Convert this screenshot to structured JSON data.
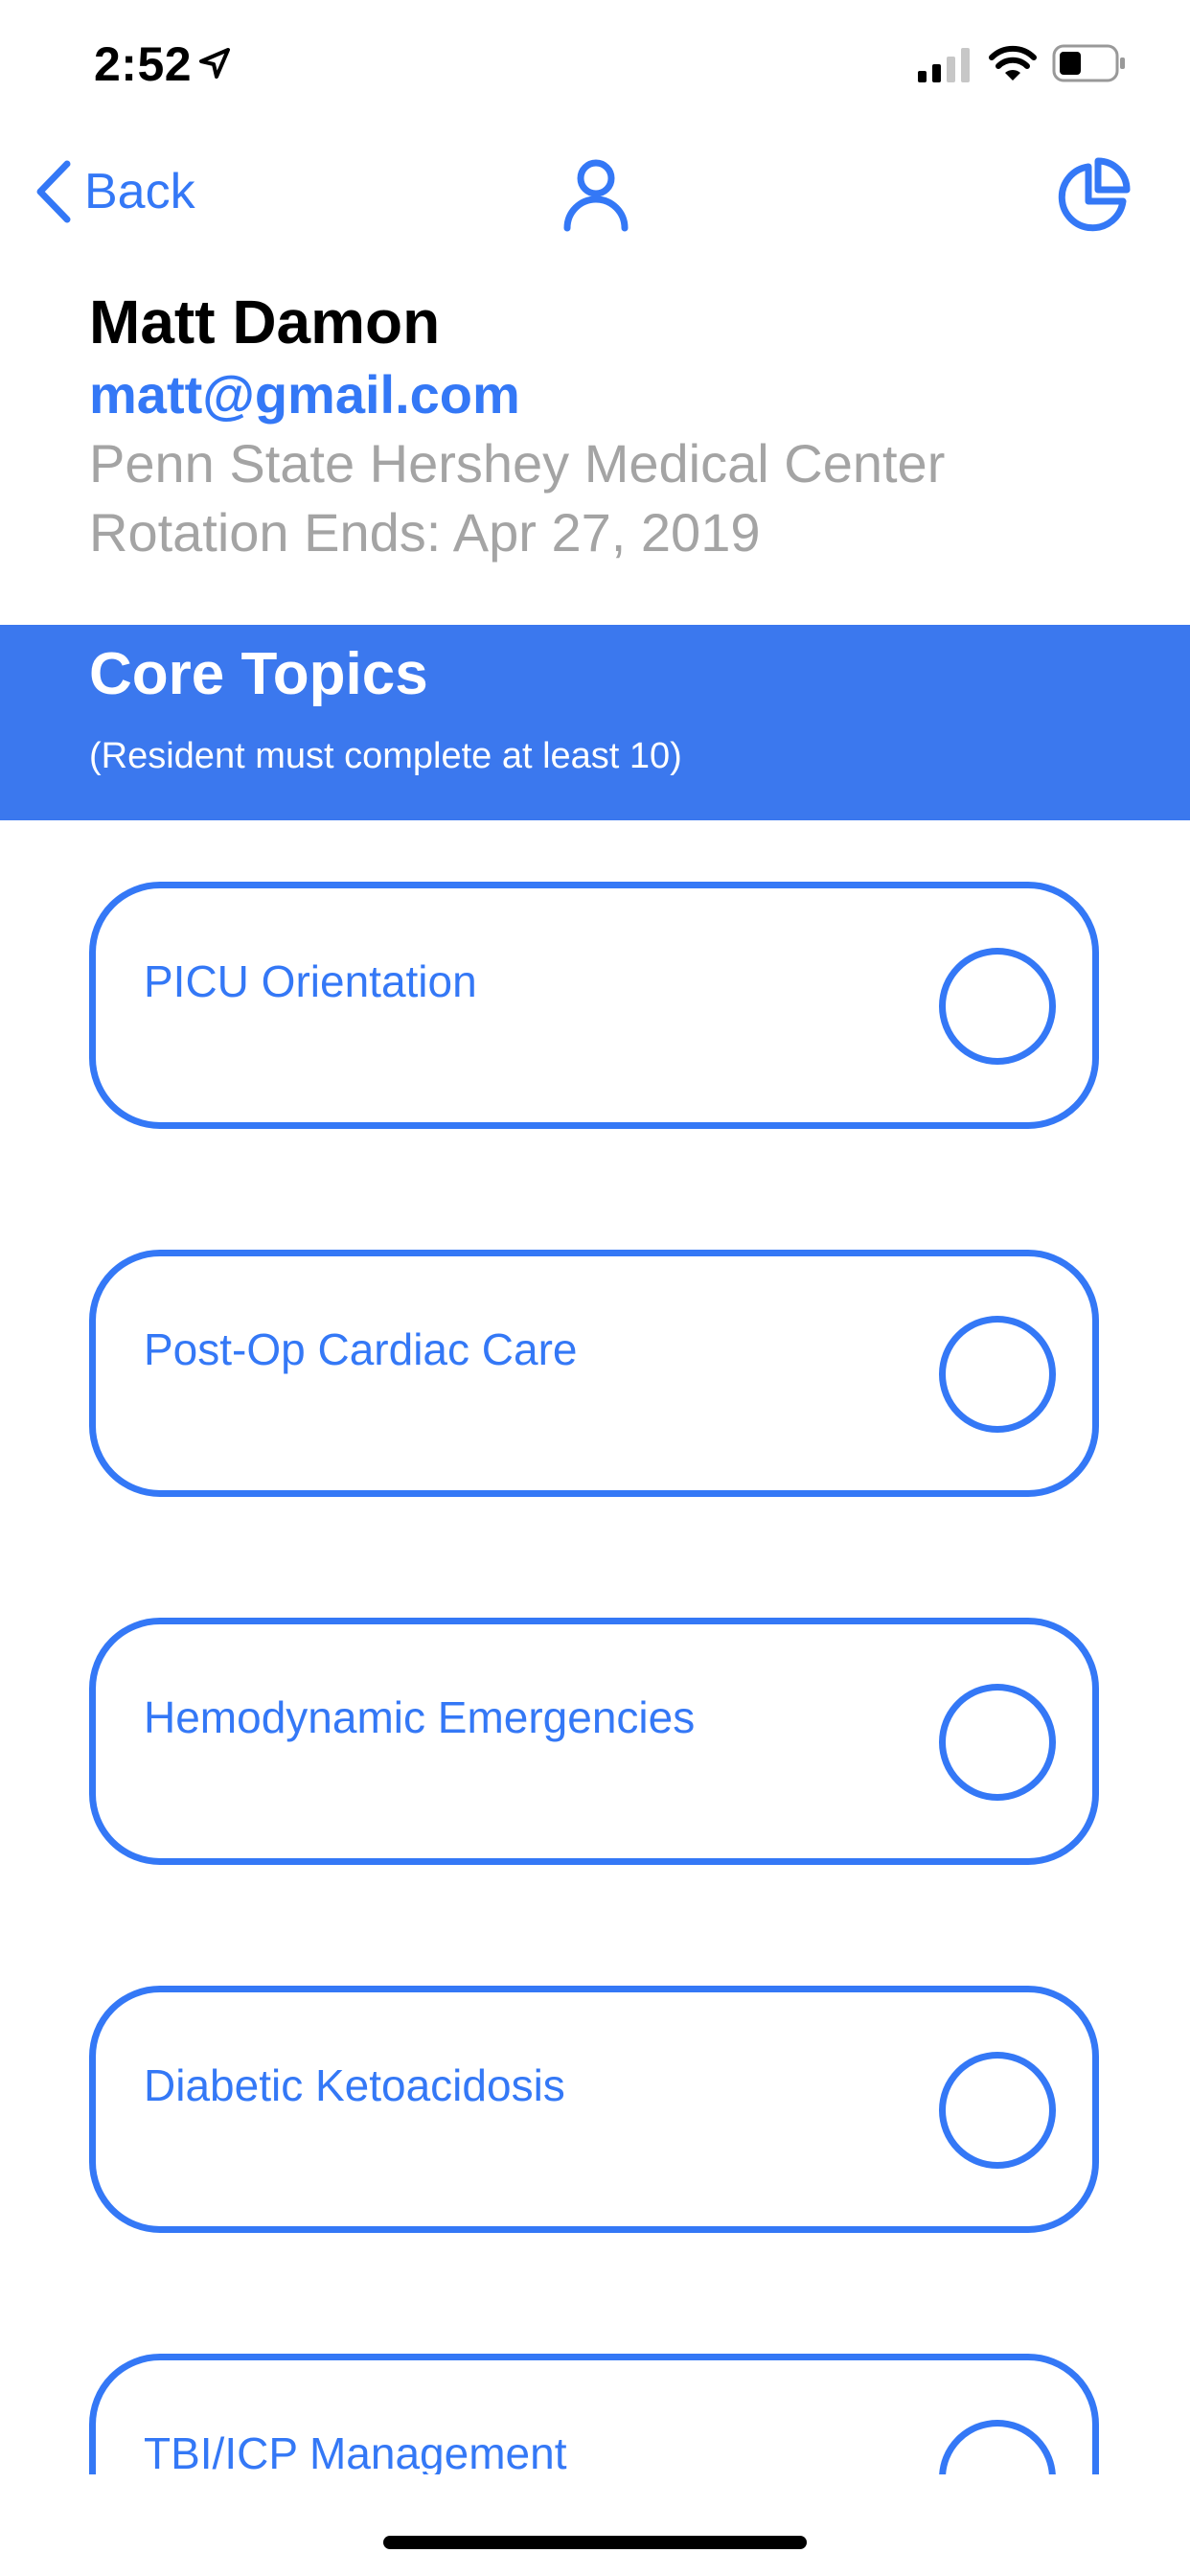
{
  "status_bar": {
    "time": "2:52"
  },
  "nav": {
    "back_label": "Back"
  },
  "user": {
    "name": "Matt Damon",
    "email": "matt@gmail.com",
    "institution": "Penn State Hershey Medical Center",
    "rotation": "Rotation Ends: Apr 27, 2019"
  },
  "section": {
    "title": "Core Topics",
    "subtitle": "(Resident must complete at least 10)"
  },
  "topics": [
    {
      "label": "PICU Orientation",
      "completed": false
    },
    {
      "label": "Post-Op Cardiac Care",
      "completed": false
    },
    {
      "label": "Hemodynamic Emergencies",
      "completed": false
    },
    {
      "label": "Diabetic Ketoacidosis",
      "completed": false
    },
    {
      "label": "TBI/ICP Management",
      "completed": false
    }
  ],
  "colors": {
    "accent": "#3478F6",
    "header_bg": "#3B78EE",
    "secondary_text": "#A4A4A4"
  },
  "icons": {
    "back": "chevron-left-icon",
    "profile": "person-icon",
    "stats": "pie-chart-icon"
  }
}
